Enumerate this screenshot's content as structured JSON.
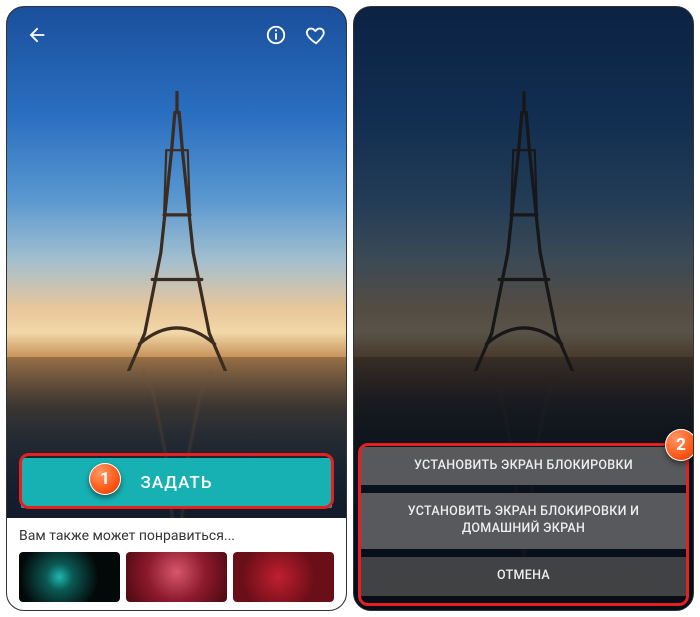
{
  "left": {
    "set_button": "ЗАДАТЬ",
    "recommendations_title": "Вам также может понравиться..."
  },
  "right": {
    "option_lock": "УСТАНОВИТЬ ЭКРАН БЛОКИРОВКИ",
    "option_both": "УСТАНОВИТЬ ЭКРАН БЛОКИРОВКИ И ДОМАШНИЙ ЭКРАН",
    "cancel": "ОТМЕНА"
  },
  "annotations": {
    "step1": "1",
    "step2": "2"
  }
}
